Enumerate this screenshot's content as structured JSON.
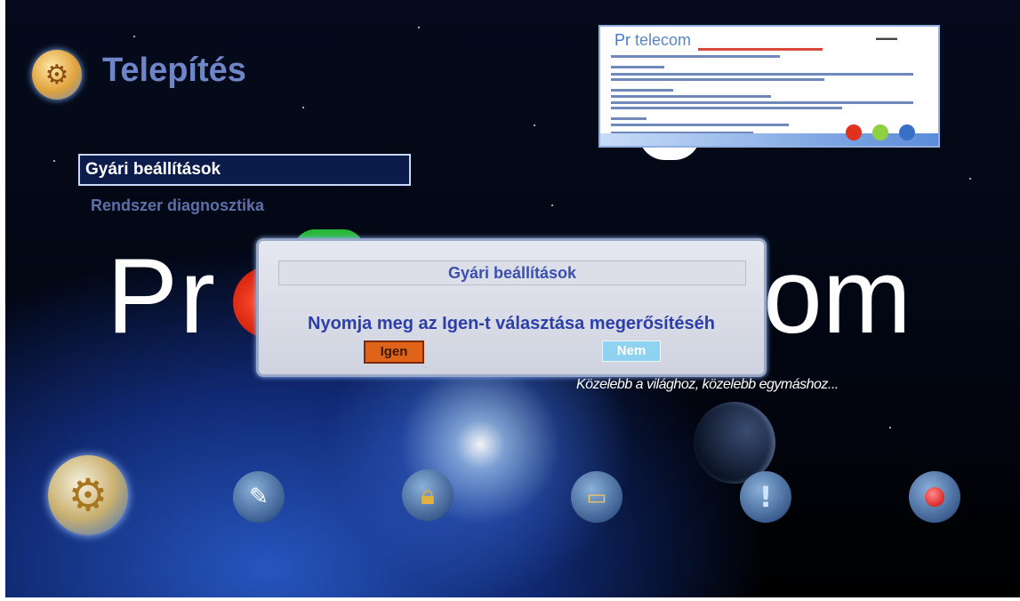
{
  "header": {
    "title": "Telepítés",
    "icon": "settings-gear-icon"
  },
  "menu": {
    "items": [
      {
        "label": "Gyári beállítások",
        "selected": true
      },
      {
        "label": "Rendszer diagnosztika",
        "selected": false
      }
    ]
  },
  "background": {
    "brand_left": "Pr",
    "brand_right": "om",
    "slogan": "Közelebb a világhoz, közelebb egymáshoz..."
  },
  "thumbnail": {
    "brand_prefix": "Pr",
    "brand_rest": "telecom"
  },
  "dialog": {
    "title": "Gyári beállítások",
    "message": "Nyomja meg az Igen-t választása megerősítéséh",
    "yes_label": "Igen",
    "no_label": "Nem",
    "focused_button": "yes"
  },
  "bottom_bar": {
    "icons": [
      "settings-gear-icon",
      "tools-icon",
      "lock-icon",
      "smartcard-icon",
      "info-icon",
      "record-icon"
    ]
  },
  "colors": {
    "title": "#6e86c8",
    "dialog_text": "#2c3fa8",
    "yes_button": "#e0631a",
    "no_button": "#8fd3f0"
  }
}
